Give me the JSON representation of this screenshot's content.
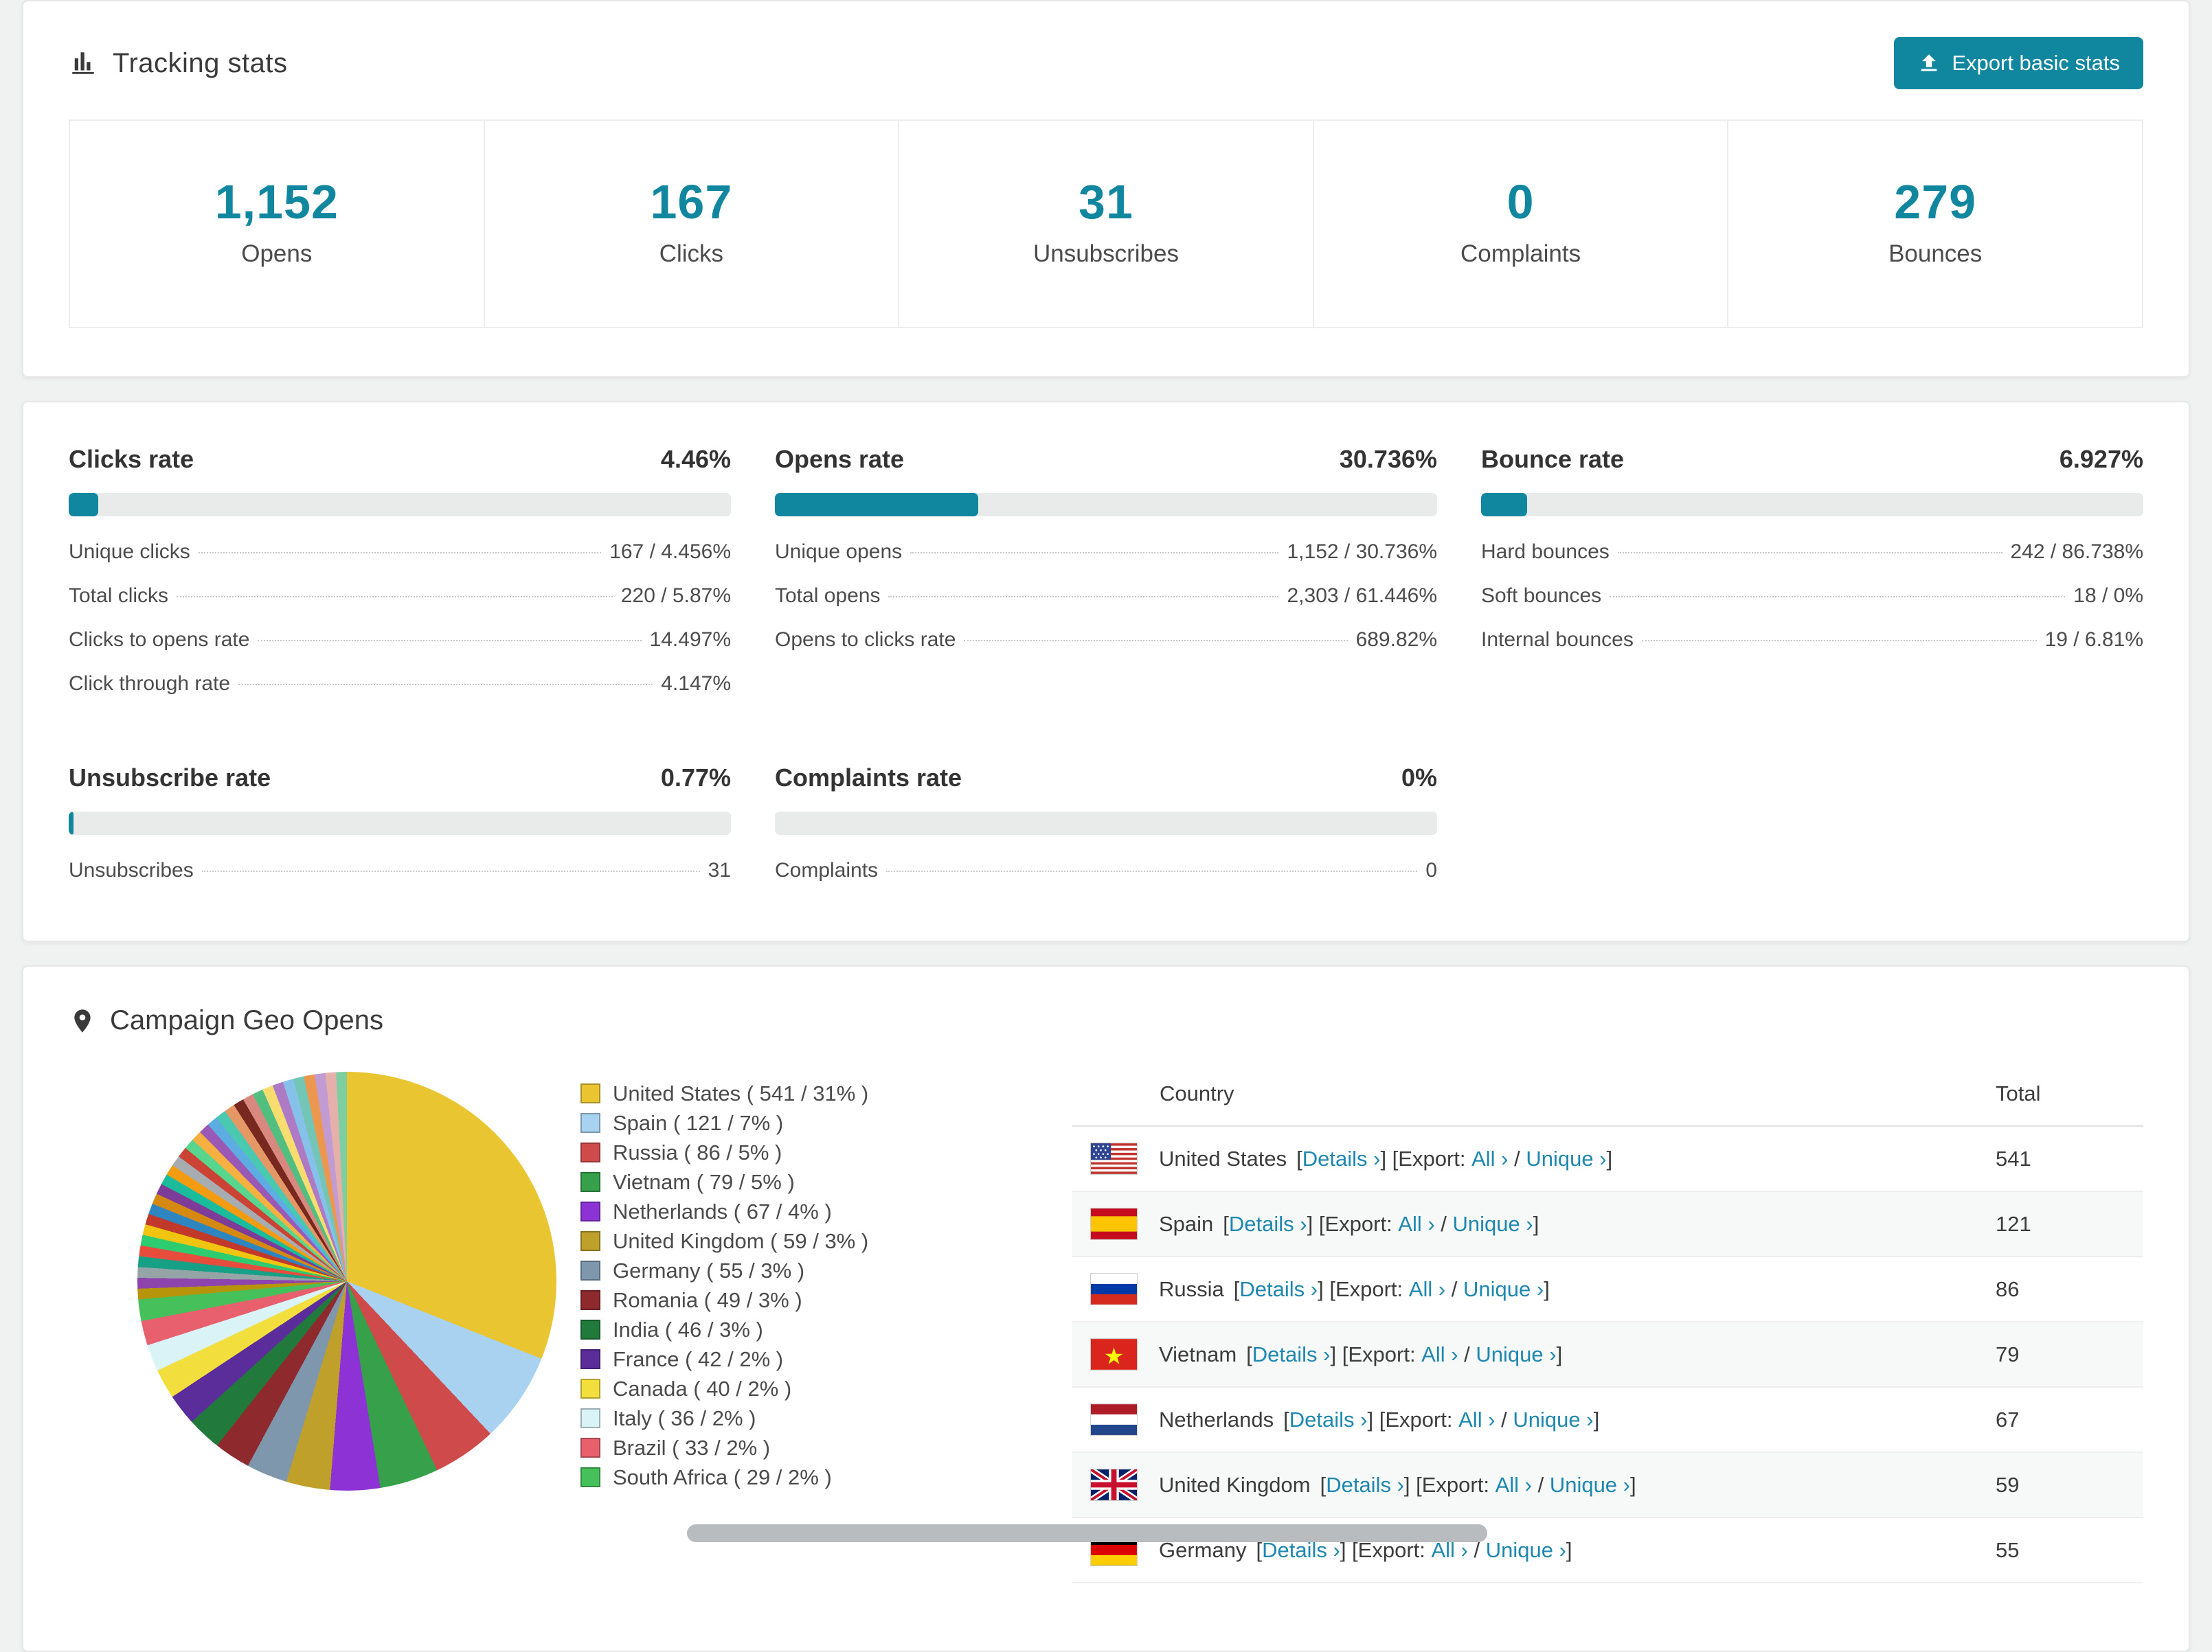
{
  "theme": {
    "accent": "#10879f",
    "link": "#1e87b0"
  },
  "tracking": {
    "title": "Tracking stats",
    "export_button": "Export basic stats",
    "stats": [
      {
        "value": "1,152",
        "label": "Opens"
      },
      {
        "value": "167",
        "label": "Clicks"
      },
      {
        "value": "31",
        "label": "Unsubscribes"
      },
      {
        "value": "0",
        "label": "Complaints"
      },
      {
        "value": "279",
        "label": "Bounces"
      }
    ]
  },
  "rates": [
    {
      "title": "Clicks rate",
      "value": "4.46%",
      "percent": 4.46,
      "rows": [
        {
          "label": "Unique clicks",
          "value": "167 / 4.456%"
        },
        {
          "label": "Total clicks",
          "value": "220 / 5.87%"
        },
        {
          "label": "Clicks to opens rate",
          "value": "14.497%"
        },
        {
          "label": "Click through rate",
          "value": "4.147%"
        }
      ]
    },
    {
      "title": "Opens rate",
      "value": "30.736%",
      "percent": 30.736,
      "rows": [
        {
          "label": "Unique opens",
          "value": "1,152 / 30.736%"
        },
        {
          "label": "Total opens",
          "value": "2,303 / 61.446%"
        },
        {
          "label": "Opens to clicks rate",
          "value": "689.82%"
        }
      ]
    },
    {
      "title": "Bounce rate",
      "value": "6.927%",
      "percent": 6.927,
      "rows": [
        {
          "label": "Hard bounces",
          "value": "242 / 86.738%"
        },
        {
          "label": "Soft bounces",
          "value": "18 / 0%"
        },
        {
          "label": "Internal bounces",
          "value": "19 / 6.81%"
        }
      ]
    },
    {
      "title": "Unsubscribe rate",
      "value": "0.77%",
      "percent": 0.77,
      "rows": [
        {
          "label": "Unsubscribes",
          "value": "31"
        }
      ]
    },
    {
      "title": "Complaints rate",
      "value": "0%",
      "percent": 0,
      "rows": [
        {
          "label": "Complaints",
          "value": "0"
        }
      ]
    }
  ],
  "geo": {
    "title": "Campaign Geo Opens",
    "table": {
      "headers": {
        "country": "Country",
        "total": "Total"
      },
      "labels": {
        "details": "Details ›",
        "export": "Export:",
        "all": "All ›",
        "unique": "Unique ›"
      },
      "rows": [
        {
          "country": "United States",
          "flag": "us",
          "total": "541"
        },
        {
          "country": "Spain",
          "flag": "es",
          "total": "121"
        },
        {
          "country": "Russia",
          "flag": "ru",
          "total": "86"
        },
        {
          "country": "Vietnam",
          "flag": "vn",
          "total": "79"
        },
        {
          "country": "Netherlands",
          "flag": "nl",
          "total": "67"
        },
        {
          "country": "United Kingdom",
          "flag": "gb",
          "total": "59"
        },
        {
          "country": "Germany",
          "flag": "de",
          "total": "55"
        }
      ]
    }
  },
  "chart_data": {
    "type": "pie",
    "title": "Campaign Geo Opens",
    "legend_position": "right",
    "series": [
      {
        "label": "United States",
        "value": 541,
        "pct": "31%",
        "color": "#e9c532"
      },
      {
        "label": "Spain",
        "value": 121,
        "pct": "7%",
        "color": "#a8d2f0"
      },
      {
        "label": "Russia",
        "value": 86,
        "pct": "5%",
        "color": "#cf4a4a"
      },
      {
        "label": "Vietnam",
        "value": 79,
        "pct": "5%",
        "color": "#36a04a"
      },
      {
        "label": "Netherlands",
        "value": 67,
        "pct": "4%",
        "color": "#8d33d6"
      },
      {
        "label": "United Kingdom",
        "value": 59,
        "pct": "3%",
        "color": "#bfa02a"
      },
      {
        "label": "Germany",
        "value": 55,
        "pct": "3%",
        "color": "#7e97ad"
      },
      {
        "label": "Romania",
        "value": 49,
        "pct": "3%",
        "color": "#8e2a2e"
      },
      {
        "label": "India",
        "value": 46,
        "pct": "3%",
        "color": "#217a3c"
      },
      {
        "label": "France",
        "value": 42,
        "pct": "2%",
        "color": "#5b2d9b"
      },
      {
        "label": "Canada",
        "value": 40,
        "pct": "2%",
        "color": "#f2de3c"
      },
      {
        "label": "Italy",
        "value": 36,
        "pct": "2%",
        "color": "#d9f3f6"
      },
      {
        "label": "Brazil",
        "value": 33,
        "pct": "2%",
        "color": "#e8606e"
      },
      {
        "label": "South Africa",
        "value": 29,
        "pct": "2%",
        "color": "#46c05a"
      }
    ],
    "others_estimated": {
      "total": 460,
      "colors": [
        "#b7950b",
        "#8e44ad",
        "#95a5a6",
        "#16a085",
        "#e74c3c",
        "#2ecc71",
        "#f1c40f",
        "#c0392b",
        "#2e86c1",
        "#d68910",
        "#7d3c98",
        "#1abc9c",
        "#f39c12",
        "#a6acaf",
        "#cb4335",
        "#58d68d",
        "#f5b041",
        "#9b59b6",
        "#5dade2",
        "#48c9b0",
        "#e59866",
        "#78281f",
        "#d98880",
        "#52be80",
        "#f7dc6f",
        "#af7ac5",
        "#85c1e9",
        "#73c6b6",
        "#eb984e",
        "#c39bd3",
        "#e6b0aa",
        "#7dcea0"
      ]
    }
  }
}
